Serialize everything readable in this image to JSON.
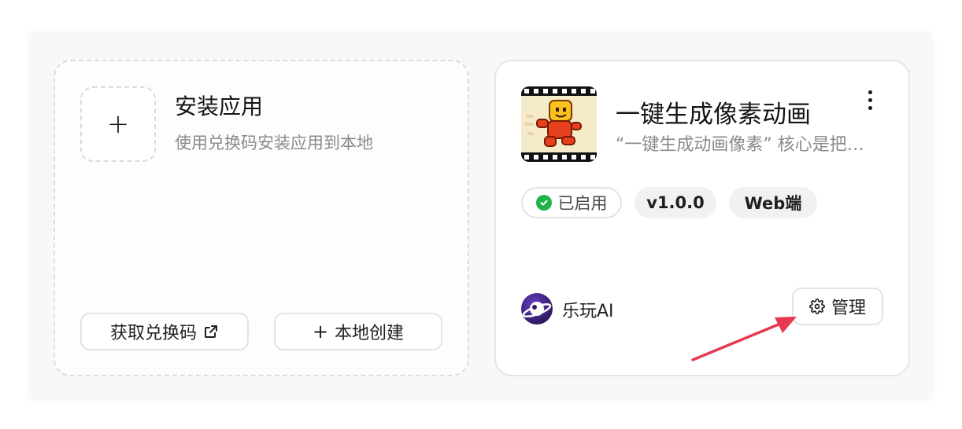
{
  "install_card": {
    "title": "安装应用",
    "description": "使用兑换码安装应用到本地",
    "plus_symbol": "+",
    "get_code_label": "获取兑换码",
    "create_local_plus": "+",
    "create_local_label": "本地创建"
  },
  "app_card": {
    "name": "一键生成像素动画",
    "description": "“一键生成动画像素” 核心是把…",
    "status_label": "已启用",
    "version": "v1.0.0",
    "platform": "Web端",
    "developer": "乐玩AI",
    "manage_label": "管理",
    "icons": {
      "more": "more-vertical-icon",
      "settings": "gear-icon",
      "external_link": "external-link-icon",
      "status": "check-circle-icon"
    }
  },
  "colors": {
    "status_green": "#22b24c",
    "arrow_red": "#e8384f"
  }
}
